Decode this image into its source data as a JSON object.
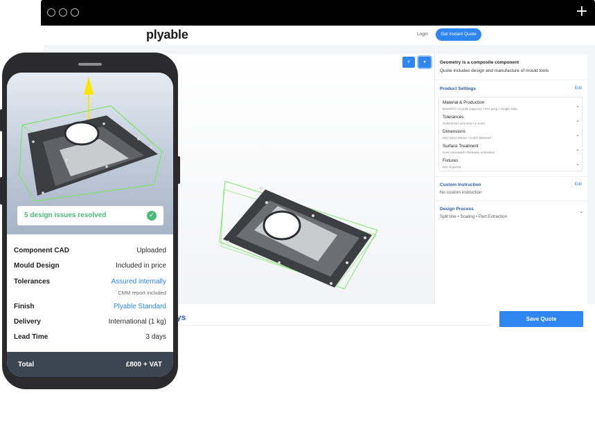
{
  "site": {
    "logo": "plyable",
    "login": "Login",
    "cta": "Get Instant Quote"
  },
  "viewer": {
    "btn_left": "#",
    "btn_right": "●"
  },
  "panel": {
    "title": "Geometry is a composite component",
    "subtitle": "Quote includes design and manufacture of mould tools",
    "product_settings": {
      "title": "Product Settings",
      "edit": "Edit",
      "rows": [
        {
          "label": "Material & Production",
          "desc": "Base978 • 6 pulls (approx) • Pre-preg • Single Side"
        },
        {
          "label": "Tolerances",
          "desc": "Subtractive process • ± 1mm"
        },
        {
          "label": "Dimensions",
          "desc": "551×551×49mm • 5,597,598mm²"
        },
        {
          "label": "Surface Treatment",
          "desc": "Seal untreated • Release untreated"
        },
        {
          "label": "Fixtures",
          "desc": "Not required"
        }
      ]
    },
    "custom_instruction": {
      "title": "Custom Instruction",
      "edit": "Edit",
      "value": "No custom instruction"
    },
    "design_process": {
      "title": "Design Process",
      "value": "Split line • Scaling • Part Extraction"
    },
    "chevron": "⌄"
  },
  "bottom": {
    "days_text": "ys",
    "save_label": "Save Quote"
  },
  "phone": {
    "toast_text": "5 design issues resolved",
    "toast_check": "✓",
    "specs": [
      {
        "label": "Component CAD",
        "value": "Uploaded",
        "link": false
      },
      {
        "label": "Mould Design",
        "value": "Included in price",
        "link": false
      },
      {
        "label": "Tolerances",
        "value": "Assured internally",
        "link": true,
        "note": "CMM report included"
      },
      {
        "label": "Finish",
        "value": "Plyable Standard",
        "link": true
      },
      {
        "label": "Delivery",
        "value": "International (1 kg)",
        "link": false
      },
      {
        "label": "Lead Time",
        "value": "3 days",
        "link": false
      }
    ],
    "total_label": "Total",
    "total_value": "£800 + VAT"
  },
  "colors": {
    "accent": "#2f86f1",
    "success": "#4cb87b",
    "heading_blue": "#2a5aa8",
    "total_bar": "#3c4652",
    "bounding_box": "#7ee36b",
    "arrow": "#ffe600"
  }
}
